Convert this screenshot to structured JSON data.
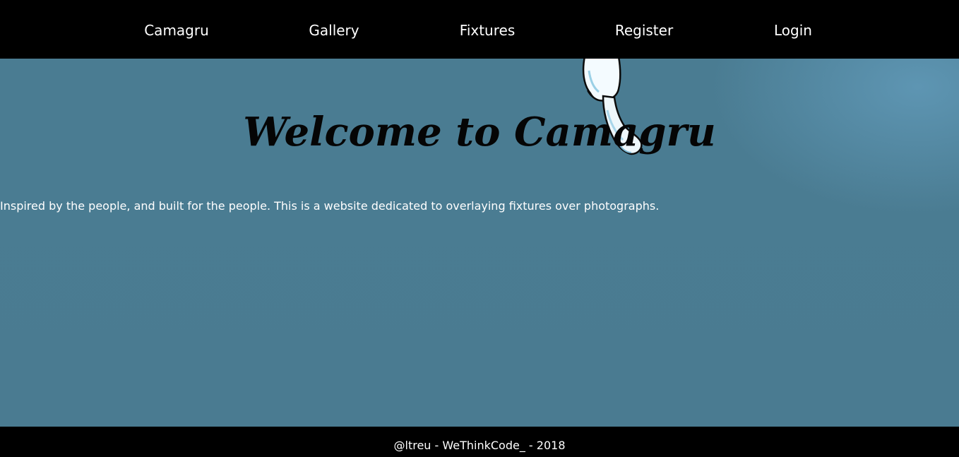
{
  "nav": {
    "items": [
      {
        "label": "Camagru"
      },
      {
        "label": "Gallery"
      },
      {
        "label": "Fixtures"
      },
      {
        "label": "Register"
      },
      {
        "label": "Login"
      }
    ]
  },
  "hero": {
    "title": "Welcome to Camagru",
    "mascot_icon": "cartoon-creature-icon"
  },
  "main": {
    "intro": "Inspired by the people, and built for the people. This is a website dedicated to overlaying fixtures over photographs."
  },
  "footer": {
    "text": "@ltreu - WeThinkCode_ - 2018"
  },
  "colors": {
    "navbar_bg": "#000000",
    "page_bg": "#4a7c92",
    "nav_text": "#ffffff",
    "title_text": "#050505",
    "footer_bg": "#000000"
  }
}
